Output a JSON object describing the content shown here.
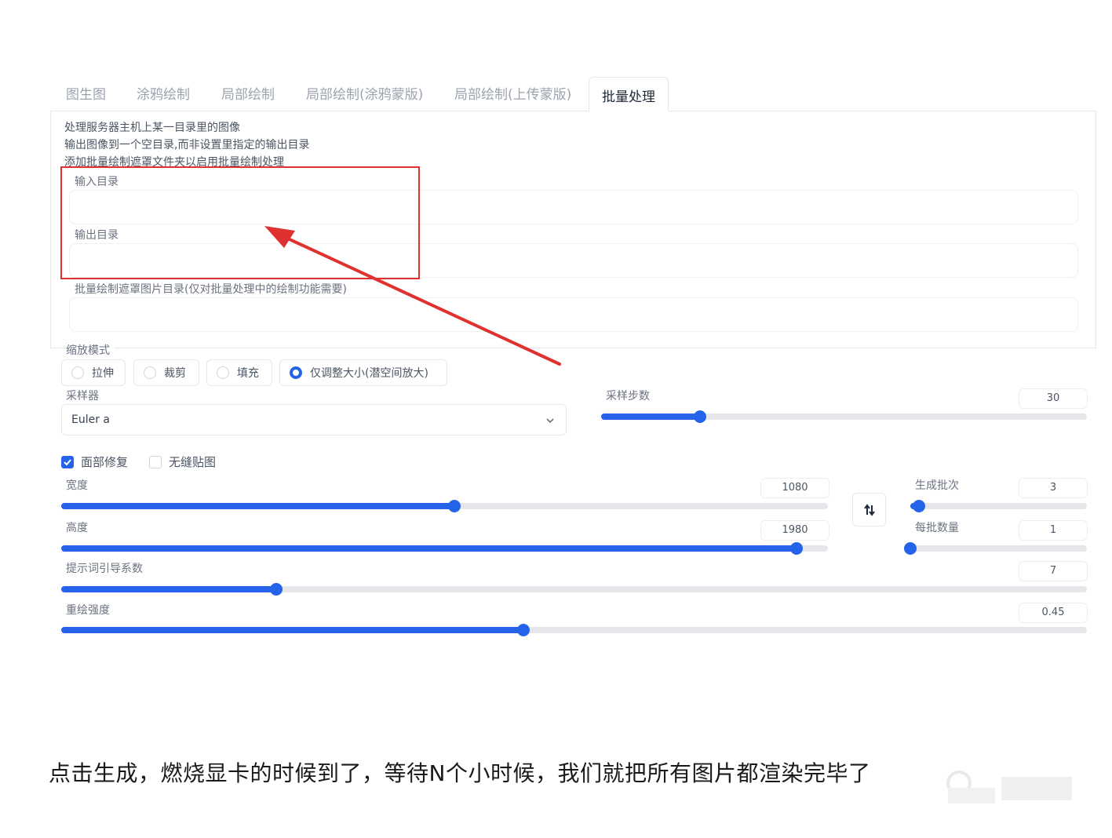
{
  "tabs": [
    "图生图",
    "涂鸦绘制",
    "局部绘制",
    "局部绘制(涂鸦蒙版)",
    "局部绘制(上传蒙版)",
    "批量处理"
  ],
  "active_tab": "批量处理",
  "batch": {
    "desc_lines": [
      "处理服务器主机上某一目录里的图像",
      "输出图像到一个空目录,而非设置里指定的输出目录",
      "添加批量绘制遮罩文件夹以启用批量绘制处理"
    ],
    "input_dir": {
      "label": "输入目录",
      "value": ""
    },
    "output_dir": {
      "label": "输出目录",
      "value": ""
    },
    "mask_dir": {
      "label": "批量绘制遮罩图片目录(仅对批量处理中的绘制功能需要)",
      "value": ""
    }
  },
  "resize_mode": {
    "label": "缩放模式",
    "options": [
      "拉伸",
      "裁剪",
      "填充",
      "仅调整大小(潜空间放大)"
    ],
    "selected": "仅调整大小(潜空间放大)"
  },
  "sampler": {
    "label": "采样器",
    "value": "Euler a"
  },
  "steps": {
    "label": "采样步数",
    "value": "30",
    "fraction": 0.203
  },
  "checkboxes": [
    {
      "label": "面部修复",
      "checked": true
    },
    {
      "label": "无缝贴图",
      "checked": false
    }
  ],
  "width": {
    "label": "宽度",
    "value": "1080",
    "fraction": 0.513
  },
  "height": {
    "label": "高度",
    "value": "1980",
    "fraction": 0.959
  },
  "batch_count": {
    "label": "生成批次",
    "value": "3",
    "fraction": 0.05
  },
  "batch_size": {
    "label": "每批数量",
    "value": "1",
    "fraction": 0.0
  },
  "cfg_scale": {
    "label": "提示词引导系数",
    "value": "7",
    "fraction": 0.21
  },
  "denoise": {
    "label": "重绘强度",
    "value": "0.45",
    "fraction": 0.451
  },
  "caption": "点击生成，燃烧显卡的时候到了，等待N个小时候，我们就把所有图片都渲染完毕了",
  "colors": {
    "accent": "#2563eb",
    "annotation": "#e03131"
  }
}
